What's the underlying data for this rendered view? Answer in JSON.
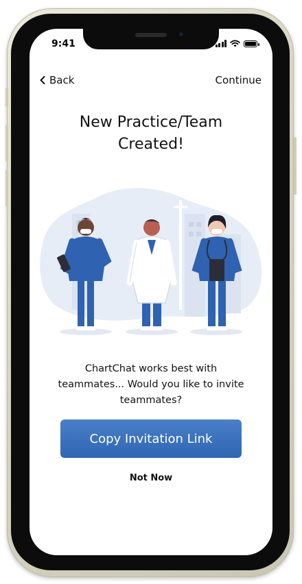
{
  "status_bar": {
    "time": "9:41"
  },
  "nav": {
    "back_label": "Back",
    "continue_label": "Continue"
  },
  "content": {
    "title": "New Practice/Team Created!",
    "message": "ChartChat works best with teammates... Would you like to invite teammates?",
    "primary_button": "Copy Invitation Link",
    "secondary_link": "Not Now"
  },
  "colors": {
    "accent": "#3a72bd",
    "scrubs": "#2f62b0",
    "background_shapes": "#e6ecf5"
  },
  "icons": [
    "chevron-left-icon",
    "signal-icon",
    "wifi-icon",
    "battery-icon"
  ]
}
